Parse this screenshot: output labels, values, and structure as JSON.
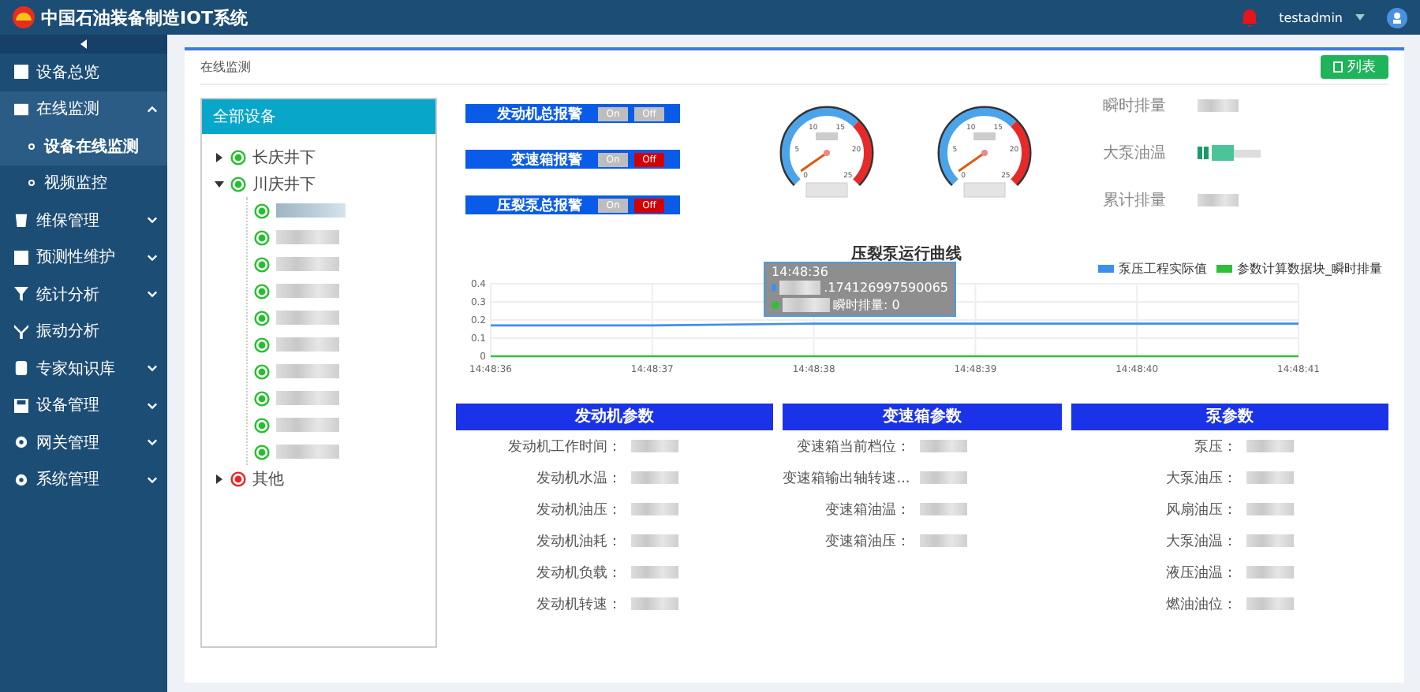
{
  "header": {
    "title": "中国石油装备制造IOT系统",
    "user": "testadmin"
  },
  "sidebar": {
    "items": [
      {
        "label": "设备总览",
        "caret": false,
        "expanded": false
      },
      {
        "label": "在线监测",
        "caret": true,
        "expanded": true,
        "children": [
          {
            "label": "设备在线监测",
            "selected": true
          },
          {
            "label": "视频监控",
            "selected": false
          }
        ]
      },
      {
        "label": "维保管理",
        "caret": true,
        "expanded": false
      },
      {
        "label": "预测性维护",
        "caret": true,
        "expanded": false
      },
      {
        "label": "统计分析",
        "caret": true,
        "expanded": false
      },
      {
        "label": "振动分析",
        "caret": false,
        "expanded": false
      },
      {
        "label": "专家知识库",
        "caret": true,
        "expanded": false
      },
      {
        "label": "设备管理",
        "caret": true,
        "expanded": false
      },
      {
        "label": "网关管理",
        "caret": true,
        "expanded": false
      },
      {
        "label": "系统管理",
        "caret": true,
        "expanded": false
      }
    ]
  },
  "breadcrumb": "在线监测",
  "list_button": "列表",
  "tree": {
    "title": "全部设备",
    "nodes": [
      {
        "label": "长庆井下",
        "color": "#22c02a",
        "expanded": false
      },
      {
        "label": "川庆井下",
        "color": "#22c02a",
        "expanded": true,
        "children": [
          {
            "color": "#22c02a",
            "selected": true
          },
          {
            "color": "#22c02a",
            "selected": false
          },
          {
            "color": "#22c02a",
            "selected": false
          },
          {
            "color": "#22c02a",
            "selected": false
          },
          {
            "color": "#22c02a",
            "selected": false
          },
          {
            "color": "#22c02a",
            "selected": false
          },
          {
            "color": "#22c02a",
            "selected": false
          },
          {
            "color": "#22c02a",
            "selected": false
          },
          {
            "color": "#22c02a",
            "selected": false
          },
          {
            "color": "#22c02a",
            "selected": false
          }
        ]
      },
      {
        "label": "其他",
        "color": "#ee2222",
        "expanded": false
      }
    ]
  },
  "alarms": [
    {
      "label": "发动机总报警",
      "on_label": "On",
      "off_label": "Off",
      "alarm": false
    },
    {
      "label": "变速箱报警",
      "on_label": "On",
      "off_label": "Off",
      "alarm": true
    },
    {
      "label": "压裂泵总报警",
      "on_label": "On",
      "off_label": "Off",
      "alarm": true
    }
  ],
  "gauges": [
    {
      "ticks": [
        "0",
        "5",
        "10",
        "15",
        "20",
        "25"
      ]
    },
    {
      "ticks": [
        "0",
        "5",
        "10",
        "15",
        "20",
        "25"
      ]
    }
  ],
  "readings": [
    {
      "label": "瞬时排量",
      "kind": "value"
    },
    {
      "label": "大泵油温",
      "kind": "bar"
    },
    {
      "label": "累计排量",
      "kind": "value"
    }
  ],
  "chart": {
    "chart_data": {
      "type": "line",
      "title": "压裂泵运行曲线",
      "categories": [
        "14:48:36",
        "14:48:37",
        "14:48:38",
        "14:48:39",
        "14:48:40",
        "14:48:41"
      ],
      "ylim": [
        0,
        0.4
      ],
      "grid": true,
      "yticks": [
        0,
        0.1,
        0.2,
        0.3,
        0.4
      ],
      "series": [
        {
          "name": "泵压工程实际值",
          "color": "#3d8ef0",
          "values": [
            0.17,
            0.17,
            0.18,
            0.18,
            0.18,
            0.18
          ]
        },
        {
          "name": "参数计算数据块_瞬时排量",
          "color": "#2fbf3a",
          "values": [
            0,
            0,
            0,
            0,
            0,
            0
          ]
        }
      ]
    },
    "tooltip": {
      "time": "14:48:36",
      "rows": [
        {
          "color": "#3d8ef0",
          "text": ".174126997590065"
        },
        {
          "color": "#2fbf3a",
          "text": "瞬时排量: 0"
        }
      ]
    }
  },
  "sections": [
    {
      "title": "发动机参数",
      "rows": [
        "发动机工作时间：",
        "发动机水温：",
        "发动机油压：",
        "发动机油耗：",
        "发动机负载：",
        "发动机转速："
      ]
    },
    {
      "title": "变速箱参数",
      "rows": [
        "变速箱当前档位：",
        "变速箱输出轴转速...",
        "变速箱油温：",
        "变速箱油压："
      ]
    },
    {
      "title": "泵参数",
      "rows": [
        "泵压：",
        "大泵油压：",
        "风扇油压：",
        "大泵油温：",
        "液压油温：",
        "燃油油位："
      ]
    }
  ]
}
